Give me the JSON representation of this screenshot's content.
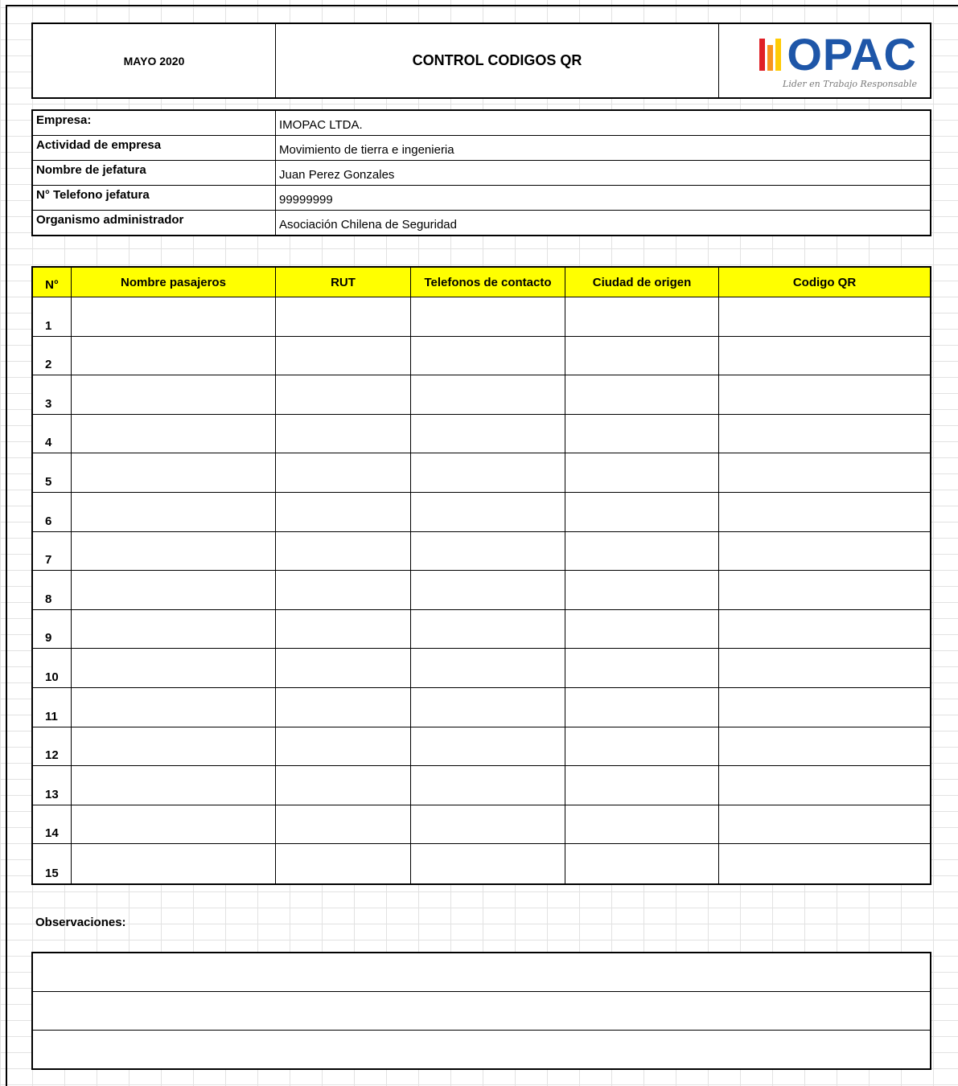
{
  "header": {
    "date": "MAYO 2020",
    "title": "CONTROL CODIGOS QR",
    "logo": {
      "text": "OPAC",
      "tagline": "Lider en Trabajo Responsable",
      "colors": {
        "word": "#1e56a8",
        "bar_red": "#e01f26",
        "bar_orange": "#f7941d",
        "bar_yellow": "#ffcb05"
      }
    }
  },
  "info": [
    {
      "label": "Empresa:",
      "value": "IMOPAC LTDA."
    },
    {
      "label": "Actividad de empresa",
      "value": "Movimiento de tierra e ingenieria"
    },
    {
      "label": "Nombre de jefatura",
      "value": "Juan Perez Gonzales"
    },
    {
      "label": "N° Telefono jefatura",
      "value": "99999999"
    },
    {
      "label": "Organismo administrador",
      "value": "Asociación Chilena de Seguridad"
    }
  ],
  "table": {
    "header_color": "#ffff00",
    "columns": [
      "N°",
      "Nombre pasajeros",
      "RUT",
      "Telefonos de contacto",
      "Ciudad de origen",
      "Codigo QR"
    ],
    "rows": [
      "1",
      "2",
      "3",
      "4",
      "5",
      "6",
      "7",
      "8",
      "9",
      "10",
      "11",
      "12",
      "13",
      "14",
      "15"
    ]
  },
  "observations": {
    "label": "Observaciones:"
  }
}
